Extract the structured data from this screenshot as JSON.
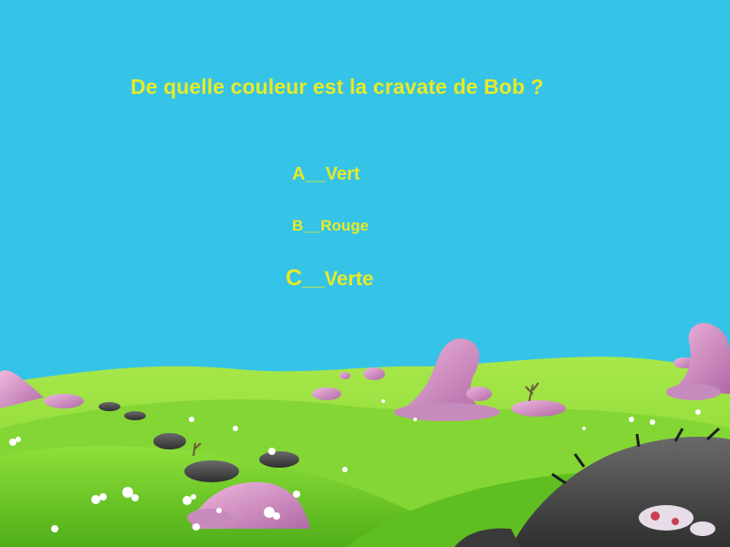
{
  "quiz": {
    "question": "De quelle couleur est la cravate de Bob ?",
    "answers": [
      {
        "letter": "A",
        "separator": "__",
        "text": "Vert"
      },
      {
        "letter": "B",
        "separator": "__",
        "text": "Rouge"
      },
      {
        "letter": "C",
        "separator": "__",
        "text": "Verte"
      }
    ]
  },
  "colors": {
    "sky": "#35c3e8",
    "text": "#e8ea26",
    "grass_far": "#8fdc3a",
    "grass_near": "#6ac322",
    "rock_pink": "#d68fc0",
    "rock_dark": "#4a4a4a"
  }
}
